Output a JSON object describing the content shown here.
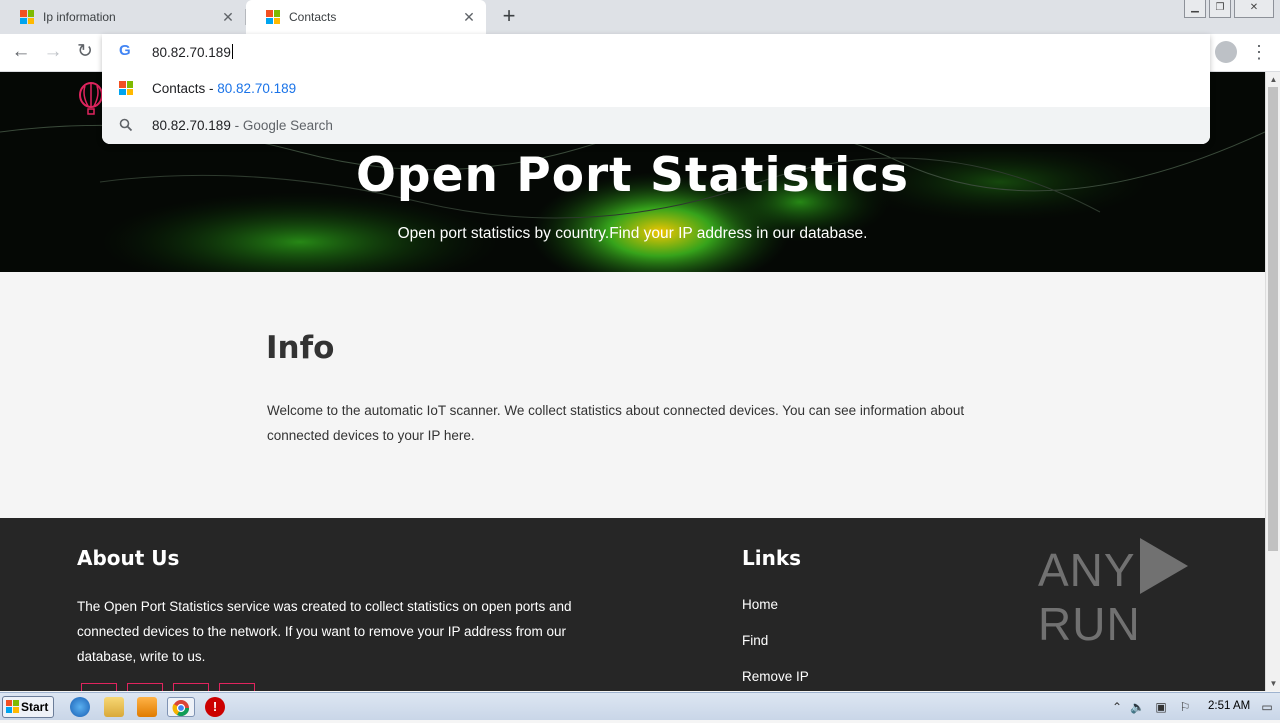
{
  "browser": {
    "tabs": [
      {
        "title": "Ip information",
        "active": false
      },
      {
        "title": "Contacts",
        "active": true
      }
    ],
    "omnibox": {
      "typed_text": "80.82.70.189",
      "suggestions": [
        {
          "prefix": "Contacts - ",
          "highlight": "80.82.70.189",
          "icon": "site-favicon"
        },
        {
          "prefix": "80.82.70.189",
          "suffix": " - Google Search",
          "icon": "search-icon"
        }
      ]
    }
  },
  "hero": {
    "title": "Open Port Statistics",
    "subtitle": "Open port statistics by country.Find your IP address in our database."
  },
  "info": {
    "title": "Info",
    "text": "Welcome to the automatic IoT scanner. We collect statistics about connected devices. You can see information about connected devices to your IP here."
  },
  "footer": {
    "about_title": "About Us",
    "about_text": "The Open Port Statistics service was created to collect statistics on open ports and connected devices to the network. If you want to remove your IP address from our database, write to us.",
    "links_title": "Links",
    "links": [
      "Home",
      "Find",
      "Remove IP"
    ]
  },
  "watermark": {
    "left": "ANY",
    "right": "RUN"
  },
  "taskbar": {
    "start_label": "Start",
    "time": "2:51 AM"
  },
  "colors": {
    "accent_link": "#1a73e8",
    "footer_bg": "#262626",
    "social_border": "#e0245e"
  }
}
